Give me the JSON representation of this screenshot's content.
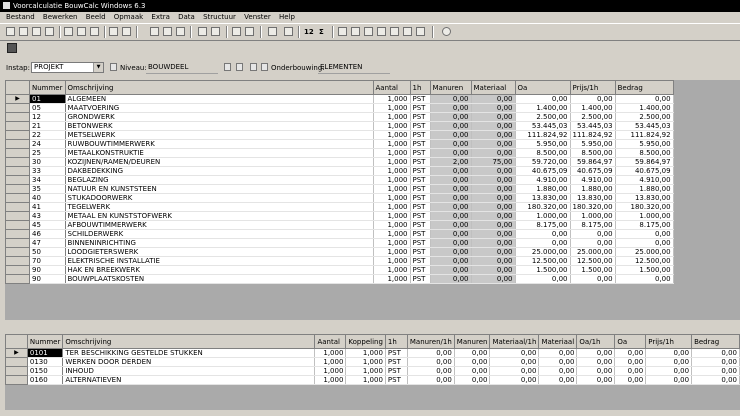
{
  "window": {
    "title": "Voorcalculatie BouwCalc Windows 6.3"
  },
  "menu": [
    "Bestand",
    "Bewerken",
    "Beeld",
    "Opmaak",
    "Extra",
    "Data",
    "Structuur",
    "Venster",
    "Help"
  ],
  "toolbar": {
    "num_label": "12",
    "sigma_label": "Σ"
  },
  "filter": {
    "instap_label": "Instap:",
    "instap_value": "PROJEKT",
    "niveau_label": "Niveau:",
    "niveau_value": "BOUWDEEL",
    "onderbouwing_label": "Onderbouwing:",
    "onderbouwing_value": "ELEMENTEN"
  },
  "top_grid": {
    "headers": [
      "Nummer",
      "Omschrijving",
      "Aantal",
      "1h",
      "Manuren",
      "Materiaal",
      "Oa",
      "Prijs/1h",
      "Bedrag"
    ],
    "rows": [
      [
        "01",
        "ALGEMEEN",
        "1,000",
        "PST",
        "0,00",
        "0,00",
        "0,00",
        "0,00",
        "0,00"
      ],
      [
        "05",
        "MAATVOERING",
        "1,000",
        "PST",
        "0,00",
        "0,00",
        "1.400,00",
        "1.400,00",
        "1.400,00"
      ],
      [
        "12",
        "GRONDWERK",
        "1,000",
        "PST",
        "0,00",
        "0,00",
        "2.500,00",
        "2.500,00",
        "2.500,00"
      ],
      [
        "21",
        "BETONWERK",
        "1,000",
        "PST",
        "0,00",
        "0,00",
        "53.445,03",
        "53.445,03",
        "53.445,03"
      ],
      [
        "22",
        "METSELWERK",
        "1,000",
        "PST",
        "0,00",
        "0,00",
        "111.824,92",
        "111.824,92",
        "111.824,92"
      ],
      [
        "24",
        "RUWBOUWTIMMERWERK",
        "1,000",
        "PST",
        "0,00",
        "0,00",
        "5.950,00",
        "5.950,00",
        "5.950,00"
      ],
      [
        "25",
        "METAALKONSTRUKTIE",
        "1,000",
        "PST",
        "0,00",
        "0,00",
        "8.500,00",
        "8.500,00",
        "8.500,00"
      ],
      [
        "30",
        "KOZIJNEN/RAMEN/DEUREN",
        "1,000",
        "PST",
        "2,00",
        "75,00",
        "59.720,00",
        "59.864,97",
        "59.864,97"
      ],
      [
        "33",
        "DAKBEDEKKING",
        "1,000",
        "PST",
        "0,00",
        "0,00",
        "40.675,09",
        "40.675,09",
        "40.675,09"
      ],
      [
        "34",
        "BEGLAZING",
        "1,000",
        "PST",
        "0,00",
        "0,00",
        "4.910,00",
        "4.910,00",
        "4.910,00"
      ],
      [
        "35",
        "NATUUR EN KUNSTSTEEN",
        "1,000",
        "PST",
        "0,00",
        "0,00",
        "1.880,00",
        "1.880,00",
        "1.880,00"
      ],
      [
        "40",
        "STUKADOORWERK",
        "1,000",
        "PST",
        "0,00",
        "0,00",
        "13.830,00",
        "13.830,00",
        "13.830,00"
      ],
      [
        "41",
        "TEGELWERK",
        "1,000",
        "PST",
        "0,00",
        "0,00",
        "180.320,00",
        "180.320,00",
        "180.320,00"
      ],
      [
        "43",
        "METAAL EN KUNSTSTOFWERK",
        "1,000",
        "PST",
        "0,00",
        "0,00",
        "1.000,00",
        "1.000,00",
        "1.000,00"
      ],
      [
        "45",
        "AFBOUWTIMMERWERK",
        "1,000",
        "PST",
        "0,00",
        "0,00",
        "8.175,00",
        "8.175,00",
        "8.175,00"
      ],
      [
        "46",
        "SCHILDERWERK",
        "1,000",
        "PST",
        "0,00",
        "0,00",
        "0,00",
        "0,00",
        "0,00"
      ],
      [
        "47",
        "BINNENINRICHTING",
        "1,000",
        "PST",
        "0,00",
        "0,00",
        "0,00",
        "0,00",
        "0,00"
      ],
      [
        "50",
        "LOODGIETERSWERK",
        "1,000",
        "PST",
        "0,00",
        "0,00",
        "25.000,00",
        "25.000,00",
        "25.000,00"
      ],
      [
        "70",
        "ELEKTRISCHE INSTALLATIE",
        "1,000",
        "PST",
        "0,00",
        "0,00",
        "12.500,00",
        "12.500,00",
        "12.500,00"
      ],
      [
        "90",
        "HAK EN BREEKWERK",
        "1,000",
        "PST",
        "0,00",
        "0,00",
        "1.500,00",
        "1.500,00",
        "1.500,00"
      ],
      [
        "90",
        "BOUWPLAATSKOSTEN",
        "1,000",
        "PST",
        "0,00",
        "0,00",
        "0,00",
        "0,00",
        "0,00"
      ]
    ]
  },
  "bottom_grid": {
    "headers": [
      "Nummer",
      "Omschrijving",
      "Aantal",
      "Koppeling",
      "1h",
      "Manuren/1h",
      "Manuren",
      "Materiaal/1h",
      "Materiaal",
      "Oa/1h",
      "Oa",
      "Prijs/1h",
      "Bedrag"
    ],
    "rows": [
      [
        "0101",
        "TER BESCHIKKING GESTELDE STUKKEN",
        "1,000",
        "1,000",
        "PST",
        "0,00",
        "0,00",
        "0,00",
        "0,00",
        "0,00",
        "0,00",
        "0,00",
        "0,00"
      ],
      [
        "0130",
        "WERKEN DOOR DERDEN",
        "1,000",
        "1,000",
        "PST",
        "0,00",
        "0,00",
        "0,00",
        "0,00",
        "0,00",
        "0,00",
        "0,00",
        "0,00"
      ],
      [
        "0150",
        "INHOUD",
        "1,000",
        "1,000",
        "PST",
        "0,00",
        "0,00",
        "0,00",
        "0,00",
        "0,00",
        "0,00",
        "0,00",
        "0,00"
      ],
      [
        "0160",
        "ALTERNATIEVEN",
        "1,000",
        "1,000",
        "PST",
        "0,00",
        "0,00",
        "0,00",
        "0,00",
        "0,00",
        "0,00",
        "0,00",
        "0,00"
      ]
    ]
  }
}
